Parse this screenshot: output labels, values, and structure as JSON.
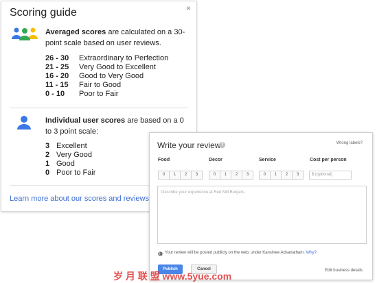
{
  "guide": {
    "title": "Scoring guide",
    "close": "×",
    "averaged": {
      "bold": "Averaged scores",
      "text": " are calculated on a 30-point scale based on user reviews."
    },
    "averaged_scores": [
      {
        "range": "26 - 30",
        "label": "Extraordinary to Perfection"
      },
      {
        "range": "21 - 25",
        "label": "Very Good to Excellent"
      },
      {
        "range": "16 - 20",
        "label": "Good to Very Good"
      },
      {
        "range": "11 - 15",
        "label": "Fair to Good"
      },
      {
        "range": "0 - 10",
        "label": "Poor to Fair"
      }
    ],
    "individual": {
      "bold": "Individual user scores",
      "text": " are based on a 0 to 3 point scale:"
    },
    "individual_scores": [
      {
        "range": "3",
        "label": "Excellent"
      },
      {
        "range": "2",
        "label": "Very Good"
      },
      {
        "range": "1",
        "label": "Good"
      },
      {
        "range": "0",
        "label": "Poor to Fair"
      }
    ],
    "learn_more": "Learn more about our scores and reviews »",
    "icon_colors": {
      "blue": "#3b78e7",
      "green": "#34a853",
      "yellow": "#fbbc05"
    }
  },
  "review": {
    "title": "Write your review",
    "wrong_labels": "Wrong labels?",
    "categories": [
      "Food",
      "Decor",
      "Service",
      "Cost per person"
    ],
    "score_options": [
      "0",
      "1",
      "2",
      "3"
    ],
    "cost_placeholder": "$ (optional)",
    "text_placeholder": "Describe your experience at Red Mill Burgers.",
    "public_note": "Your review will be posted publicly on the web, under Kansinee Adsanatham.",
    "why": "Why?",
    "submit": "Publish",
    "cancel": "Cancel",
    "edit_details": "Edit business details",
    "accent": "#4a86e8"
  },
  "watermark": "岁 月 联 盟  www.5yue.com"
}
